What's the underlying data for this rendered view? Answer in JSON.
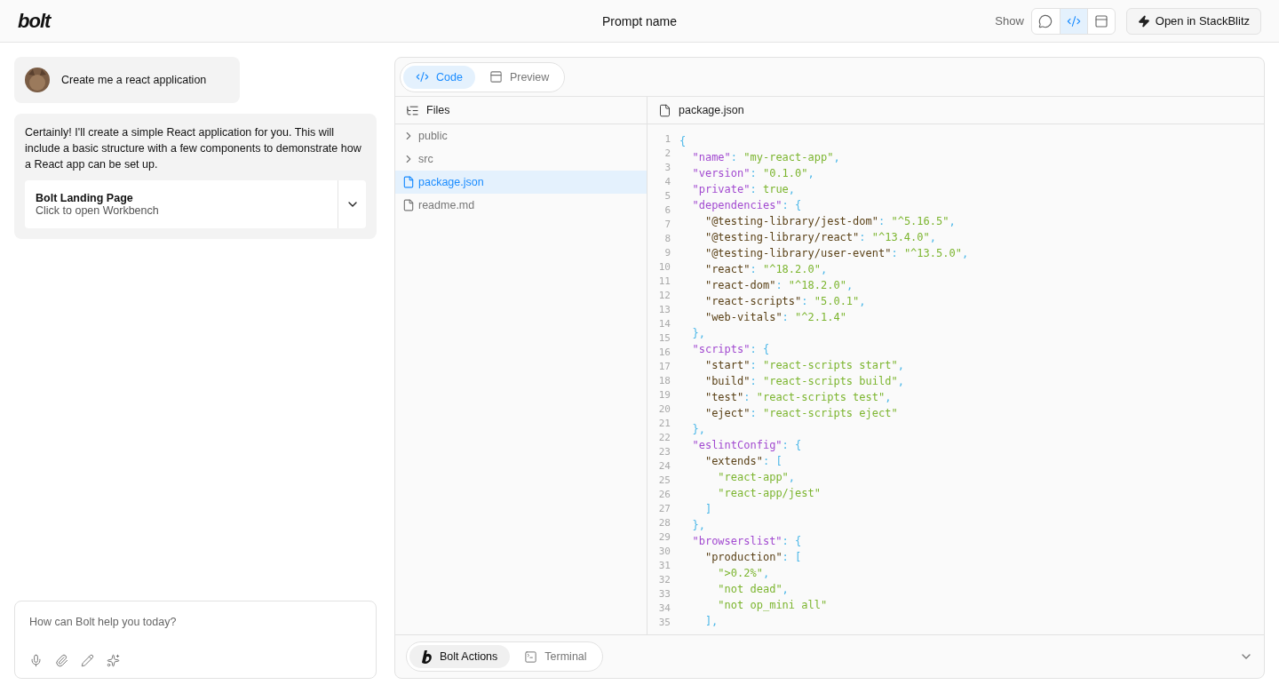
{
  "header": {
    "logo": "bolt",
    "title": "Prompt name",
    "show_label": "Show",
    "view_buttons": [
      {
        "kind": "chat",
        "selected": false
      },
      {
        "kind": "code",
        "selected": true
      },
      {
        "kind": "preview",
        "selected": false
      }
    ],
    "open_button": "Open in StackBlitz"
  },
  "chat": {
    "user_message": "Create me a react application",
    "assistant_message": "Certainly! I'll create a simple React application for you. This will include a basic structure with a few components to demonstrate how a React app can be set up.",
    "artifact": {
      "title": "Bolt Landing Page",
      "subtitle": "Click to open Workbench"
    },
    "input": {
      "placeholder": "How can Bolt help you today?"
    },
    "tools": [
      {
        "kind": "mic"
      },
      {
        "kind": "attach"
      },
      {
        "kind": "pencil"
      },
      {
        "kind": "sparkles"
      }
    ]
  },
  "workbench": {
    "tabs": [
      {
        "kind": "code",
        "label": "Code",
        "selected": true
      },
      {
        "kind": "preview",
        "label": "Preview",
        "selected": false
      }
    ],
    "files_title": "Files",
    "files": [
      {
        "kind": "folder",
        "name": "public",
        "selected": false
      },
      {
        "kind": "folder",
        "name": "src",
        "selected": false
      },
      {
        "kind": "file",
        "name": "package.json",
        "selected": true
      },
      {
        "kind": "file",
        "name": "readme.md",
        "selected": false
      }
    ],
    "editor_title": "package.json",
    "line_numbers": [
      "1",
      "2",
      "3",
      "4",
      "5",
      "6",
      "7",
      "8",
      "9",
      "10",
      "11",
      "12",
      "13",
      "14",
      "15",
      "16",
      "17",
      "18",
      "19",
      "20",
      "21",
      "22",
      "23",
      "24",
      "25",
      "26",
      "27",
      "28",
      "29",
      "30",
      "31",
      "32",
      "33",
      "34",
      "35"
    ],
    "code": [
      "{",
      "  \"name\": \"my-react-app\",",
      "  \"version\": \"0.1.0\",",
      "  \"private\": true,",
      "  \"dependencies\": {",
      "    \"@testing-library/jest-dom\": \"^5.16.5\",",
      "    \"@testing-library/react\": \"^13.4.0\",",
      "    \"@testing-library/user-event\": \"^13.5.0\",",
      "    \"react\": \"^18.2.0\",",
      "    \"react-dom\": \"^18.2.0\",",
      "    \"react-scripts\": \"5.0.1\",",
      "    \"web-vitals\": \"^2.1.4\"",
      "  },",
      "  \"scripts\": {",
      "    \"start\": \"react-scripts start\",",
      "    \"build\": \"react-scripts build\",",
      "    \"test\": \"react-scripts test\",",
      "    \"eject\": \"react-scripts eject\"",
      "  },",
      "  \"eslintConfig\": {",
      "    \"extends\": [",
      "      \"react-app\",",
      "      \"react-app/jest\"",
      "    ]",
      "  },",
      "  \"browserslist\": {",
      "    \"production\": [",
      "      \">0.2%\",",
      "      \"not dead\",",
      "      \"not op_mini all\"",
      "    ],"
    ],
    "bottom_tabs": [
      {
        "kind": "actions",
        "label": "Bolt Actions",
        "selected": true
      },
      {
        "kind": "terminal",
        "label": "Terminal",
        "selected": false
      }
    ]
  }
}
